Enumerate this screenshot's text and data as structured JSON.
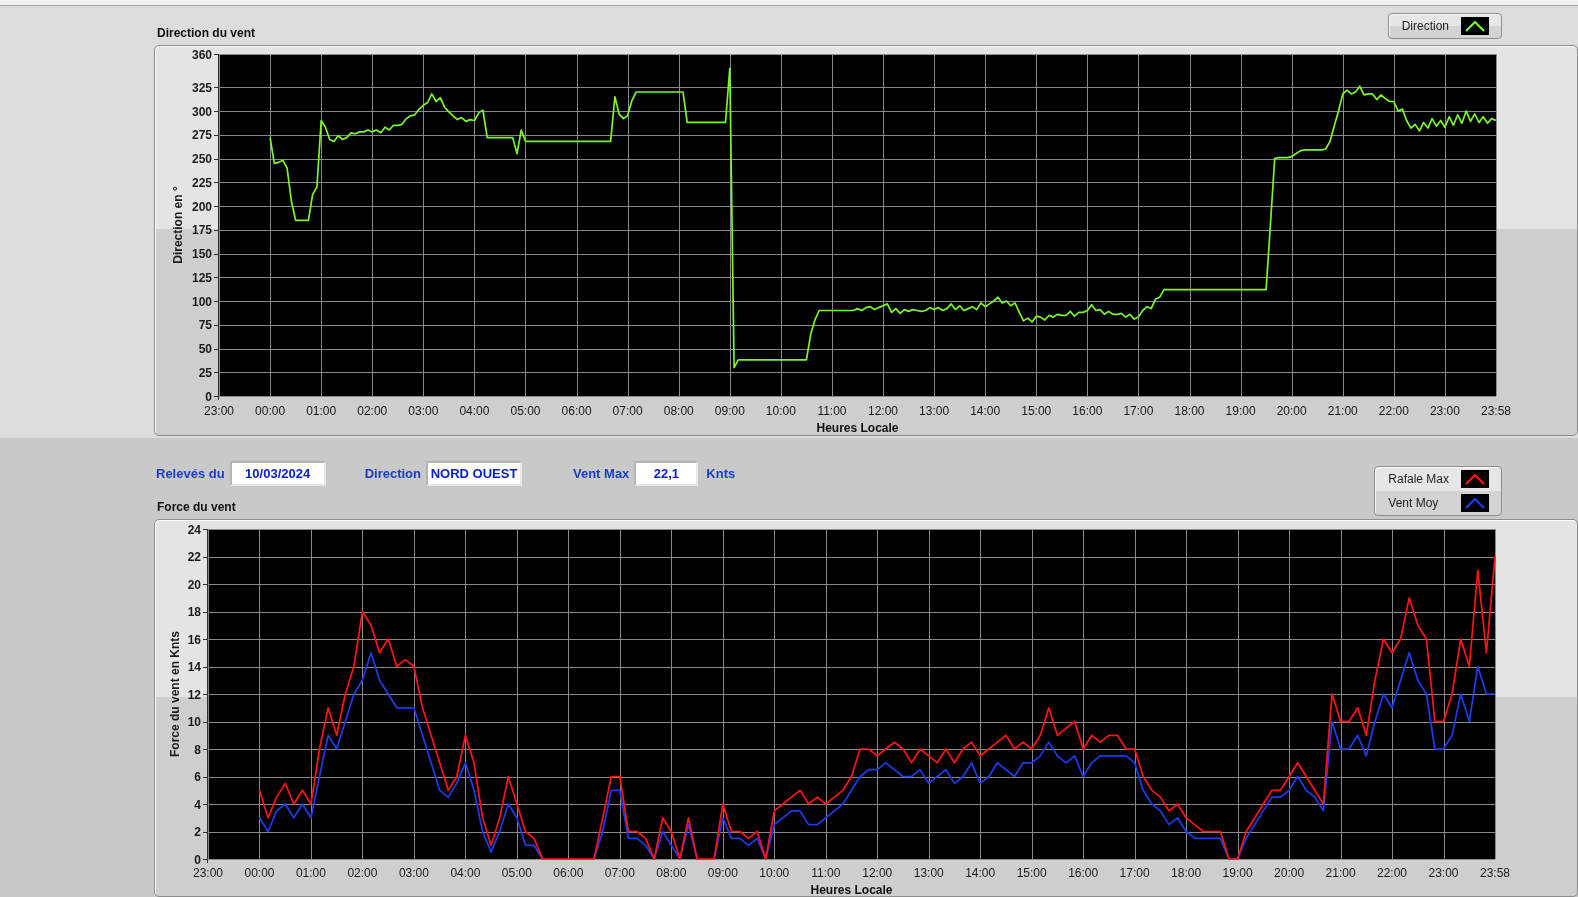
{
  "direction_panel": {
    "title": "Direction du vent",
    "chart_data": {
      "type": "line",
      "grid": true,
      "xlabel": "Heures Locale",
      "ylabel": "Direction en °",
      "categories": [
        "23:00",
        null,
        null,
        null,
        null,
        null,
        null,
        null,
        null,
        null,
        null,
        null,
        "00:00",
        null,
        null,
        null,
        null,
        null,
        null,
        null,
        null,
        null,
        null,
        null,
        "01:00",
        null,
        null,
        null,
        null,
        null,
        null,
        null,
        null,
        null,
        null,
        null,
        "02:00",
        null,
        null,
        null,
        null,
        null,
        null,
        null,
        null,
        null,
        null,
        null,
        "03:00",
        null,
        null,
        null,
        null,
        null,
        null,
        null,
        null,
        null,
        null,
        null,
        "04:00",
        null,
        null,
        null,
        null,
        null,
        null,
        null,
        null,
        null,
        null,
        null,
        "05:00",
        null,
        null,
        null,
        null,
        null,
        null,
        null,
        null,
        null,
        null,
        null,
        "06:00",
        null,
        null,
        null,
        null,
        null,
        null,
        null,
        null,
        null,
        null,
        null,
        "07:00",
        null,
        null,
        null,
        null,
        null,
        null,
        null,
        null,
        null,
        null,
        null,
        "08:00",
        null,
        null,
        null,
        null,
        null,
        null,
        null,
        null,
        null,
        null,
        null,
        "09:00",
        null,
        null,
        null,
        null,
        null,
        null,
        null,
        null,
        null,
        null,
        null,
        "10:00",
        null,
        null,
        null,
        null,
        null,
        null,
        null,
        null,
        null,
        null,
        null,
        "11:00",
        null,
        null,
        null,
        null,
        null,
        null,
        null,
        null,
        null,
        null,
        null,
        "12:00",
        null,
        null,
        null,
        null,
        null,
        null,
        null,
        null,
        null,
        null,
        null,
        "13:00",
        null,
        null,
        null,
        null,
        null,
        null,
        null,
        null,
        null,
        null,
        null,
        "14:00",
        null,
        null,
        null,
        null,
        null,
        null,
        null,
        null,
        null,
        null,
        null,
        "15:00",
        null,
        null,
        null,
        null,
        null,
        null,
        null,
        null,
        null,
        null,
        null,
        "16:00",
        null,
        null,
        null,
        null,
        null,
        null,
        null,
        null,
        null,
        null,
        null,
        "17:00",
        null,
        null,
        null,
        null,
        null,
        null,
        null,
        null,
        null,
        null,
        null,
        "18:00",
        null,
        null,
        null,
        null,
        null,
        null,
        null,
        null,
        null,
        null,
        null,
        "19:00",
        null,
        null,
        null,
        null,
        null,
        null,
        null,
        null,
        null,
        null,
        null,
        "20:00",
        null,
        null,
        null,
        null,
        null,
        null,
        null,
        null,
        null,
        null,
        null,
        "21:00",
        null,
        null,
        null,
        null,
        null,
        null,
        null,
        null,
        null,
        null,
        null,
        "22:00",
        null,
        null,
        null,
        null,
        null,
        null,
        null,
        null,
        null,
        null,
        null,
        "23:00",
        null,
        null,
        null,
        null,
        null,
        null,
        null,
        null,
        null,
        null,
        null,
        "23:58"
      ],
      "series": [
        {
          "name": "Direction",
          "color": "#7cf52a",
          "values": [
            null,
            null,
            null,
            null,
            null,
            null,
            null,
            null,
            null,
            null,
            null,
            null,
            272,
            245,
            246,
            248,
            240,
            205,
            185,
            185,
            185,
            185,
            212,
            220,
            290,
            283,
            270,
            268,
            274,
            270,
            272,
            277,
            276,
            278,
            278,
            280,
            278,
            280,
            277,
            283,
            280,
            285,
            285,
            286,
            292,
            295,
            296,
            302,
            306,
            309,
            318,
            310,
            314,
            304,
            299,
            295,
            291,
            293,
            289,
            291,
            290,
            298,
            301,
            272,
            272,
            272,
            272,
            272,
            272,
            272,
            255,
            280,
            268,
            268,
            268,
            268,
            268,
            268,
            268,
            268,
            268,
            268,
            268,
            268,
            268,
            268,
            268,
            268,
            268,
            268,
            268,
            268,
            268,
            315,
            297,
            292,
            295,
            311,
            320,
            320,
            320,
            320,
            320,
            320,
            320,
            320,
            320,
            320,
            320,
            320,
            288,
            288,
            288,
            288,
            288,
            288,
            288,
            288,
            288,
            288,
            345,
            30,
            38,
            38,
            38,
            38,
            38,
            38,
            38,
            38,
            38,
            38,
            38,
            38,
            38,
            38,
            38,
            38,
            38,
            65,
            80,
            90,
            90,
            90,
            90,
            90,
            90,
            90,
            90,
            90,
            92,
            90,
            93,
            94,
            91,
            93,
            95,
            97,
            88,
            92,
            87,
            91,
            89,
            91,
            90,
            89,
            90,
            93,
            91,
            93,
            90,
            92,
            97,
            91,
            95,
            90,
            92,
            94,
            91,
            98,
            94,
            97,
            100,
            104,
            98,
            100,
            95,
            98,
            88,
            79,
            82,
            78,
            84,
            83,
            80,
            85,
            83,
            86,
            85,
            85,
            89,
            84,
            88,
            88,
            90,
            96,
            90,
            91,
            86,
            89,
            86,
            86,
            87,
            83,
            86,
            81,
            83,
            90,
            94,
            92,
            102,
            104,
            112,
            112,
            112,
            112,
            112,
            112,
            112,
            112,
            112,
            112,
            112,
            112,
            112,
            112,
            112,
            112,
            112,
            112,
            112,
            112,
            112,
            112,
            112,
            112,
            112,
            180,
            250,
            251,
            251,
            251,
            252,
            255,
            258,
            259,
            259,
            259,
            259,
            259,
            260,
            268,
            284,
            300,
            318,
            322,
            318,
            320,
            326,
            317,
            318,
            318,
            312,
            317,
            313,
            310,
            310,
            300,
            302,
            290,
            282,
            286,
            279,
            288,
            282,
            292,
            284,
            290,
            283,
            294,
            285,
            296,
            287,
            300,
            289,
            297,
            288,
            294,
            287,
            292,
            290
          ]
        }
      ],
      "ylim": [
        0,
        360
      ],
      "yticks": [
        0,
        25,
        50,
        75,
        100,
        125,
        150,
        175,
        200,
        225,
        250,
        275,
        300,
        325,
        360
      ]
    }
  },
  "readings": [
    {
      "label": "Relevés du",
      "value": "10/03/2024"
    },
    {
      "label": "Direction",
      "value": "NORD OUEST"
    },
    {
      "label": "Vent Max",
      "value": "22,1",
      "unit": "Knts"
    }
  ],
  "force_panel": {
    "title": "Force du vent",
    "chart_data": {
      "type": "line",
      "grid": true,
      "xlabel": "Heures Locale",
      "ylabel": "Force du vent en Knts",
      "categories": [
        "23:00",
        null,
        null,
        null,
        null,
        null,
        "00:00",
        null,
        null,
        null,
        null,
        null,
        "01:00",
        null,
        null,
        null,
        null,
        null,
        "02:00",
        null,
        null,
        null,
        null,
        null,
        "03:00",
        null,
        null,
        null,
        null,
        null,
        "04:00",
        null,
        null,
        null,
        null,
        null,
        "05:00",
        null,
        null,
        null,
        null,
        null,
        "06:00",
        null,
        null,
        null,
        null,
        null,
        "07:00",
        null,
        null,
        null,
        null,
        null,
        "08:00",
        null,
        null,
        null,
        null,
        null,
        "09:00",
        null,
        null,
        null,
        null,
        null,
        "10:00",
        null,
        null,
        null,
        null,
        null,
        "11:00",
        null,
        null,
        null,
        null,
        null,
        "12:00",
        null,
        null,
        null,
        null,
        null,
        "13:00",
        null,
        null,
        null,
        null,
        null,
        "14:00",
        null,
        null,
        null,
        null,
        null,
        "15:00",
        null,
        null,
        null,
        null,
        null,
        "16:00",
        null,
        null,
        null,
        null,
        null,
        "17:00",
        null,
        null,
        null,
        null,
        null,
        "18:00",
        null,
        null,
        null,
        null,
        null,
        "19:00",
        null,
        null,
        null,
        null,
        null,
        "20:00",
        null,
        null,
        null,
        null,
        null,
        "21:00",
        null,
        null,
        null,
        null,
        null,
        "22:00",
        null,
        null,
        null,
        null,
        null,
        "23:00",
        null,
        null,
        null,
        null,
        null,
        "23:58"
      ],
      "series": [
        {
          "name": "Rafale Max",
          "color": "#ff1414",
          "values": [
            null,
            null,
            null,
            null,
            null,
            null,
            5,
            3,
            4.5,
            5.5,
            4,
            5,
            4,
            8,
            11,
            9,
            12,
            14,
            18,
            17,
            15,
            16,
            14,
            14.5,
            14,
            11,
            9,
            7,
            5,
            6,
            9,
            7,
            3,
            1,
            3,
            6,
            4,
            2,
            1.5,
            0,
            0,
            0,
            0,
            0,
            0,
            0,
            3,
            6,
            6,
            2,
            2,
            1.5,
            0,
            3,
            2,
            0,
            3,
            0,
            0,
            0,
            4,
            2,
            2,
            1.5,
            2,
            0,
            3.5,
            4,
            4.5,
            5,
            4,
            4.5,
            4,
            4.5,
            5,
            6,
            8,
            8,
            7.5,
            8,
            8.5,
            8,
            7,
            8,
            7.5,
            7,
            8,
            7,
            8,
            8.5,
            7.5,
            8,
            8.5,
            9,
            8,
            8.5,
            8,
            9,
            11,
            9,
            9.5,
            10,
            8,
            9,
            8.5,
            9,
            9,
            8,
            8,
            6,
            5,
            4.5,
            3.5,
            4,
            3,
            2.5,
            2,
            2,
            2,
            0,
            0,
            2,
            3,
            4,
            5,
            5,
            6,
            7,
            6,
            5,
            4,
            12,
            10,
            10,
            11,
            9,
            13,
            16,
            15,
            16,
            19,
            17,
            16,
            10,
            10,
            12,
            16,
            14,
            21,
            15,
            22
          ]
        },
        {
          "name": "Vent Moy",
          "color": "#1c3cf0",
          "values": [
            null,
            null,
            null,
            null,
            null,
            null,
            3,
            2,
            3.5,
            4,
            3,
            4,
            3,
            6,
            9,
            8,
            10,
            12,
            13,
            15,
            13,
            12,
            11,
            11,
            11,
            9,
            7,
            5,
            4.5,
            5.5,
            7,
            5,
            2,
            0.5,
            2,
            4,
            3,
            1,
            1,
            0,
            null,
            null,
            null,
            null,
            null,
            0,
            2,
            5,
            5,
            1.5,
            1.5,
            1,
            0,
            2,
            1,
            0,
            2.5,
            0,
            null,
            0,
            3,
            1.5,
            1.5,
            1,
            1.5,
            0,
            2.5,
            3,
            3.5,
            3.5,
            2.5,
            2.5,
            3,
            3.5,
            4,
            5,
            6,
            6.5,
            6.5,
            7,
            6.5,
            6,
            6,
            6.5,
            5.5,
            6,
            6.5,
            5.5,
            6,
            7,
            5.5,
            6,
            7,
            6.5,
            6,
            7,
            7,
            7.5,
            8.5,
            7.5,
            7,
            7.5,
            6,
            7,
            7.5,
            7.5,
            7.5,
            7.5,
            7,
            5,
            4,
            3.5,
            2.5,
            3,
            2,
            1.5,
            1.5,
            1.5,
            1.5,
            0,
            0,
            1.5,
            2.5,
            3.5,
            4.5,
            4.5,
            5,
            6,
            5,
            4.5,
            3.5,
            10,
            8,
            8,
            9,
            7.5,
            10,
            12,
            11,
            13,
            15,
            13,
            12,
            8,
            8,
            9,
            12,
            10,
            14,
            12,
            12
          ]
        }
      ],
      "ylim": [
        0,
        24
      ],
      "yticks": [
        0,
        2,
        4,
        6,
        8,
        10,
        12,
        14,
        16,
        18,
        20,
        22,
        24
      ]
    }
  }
}
